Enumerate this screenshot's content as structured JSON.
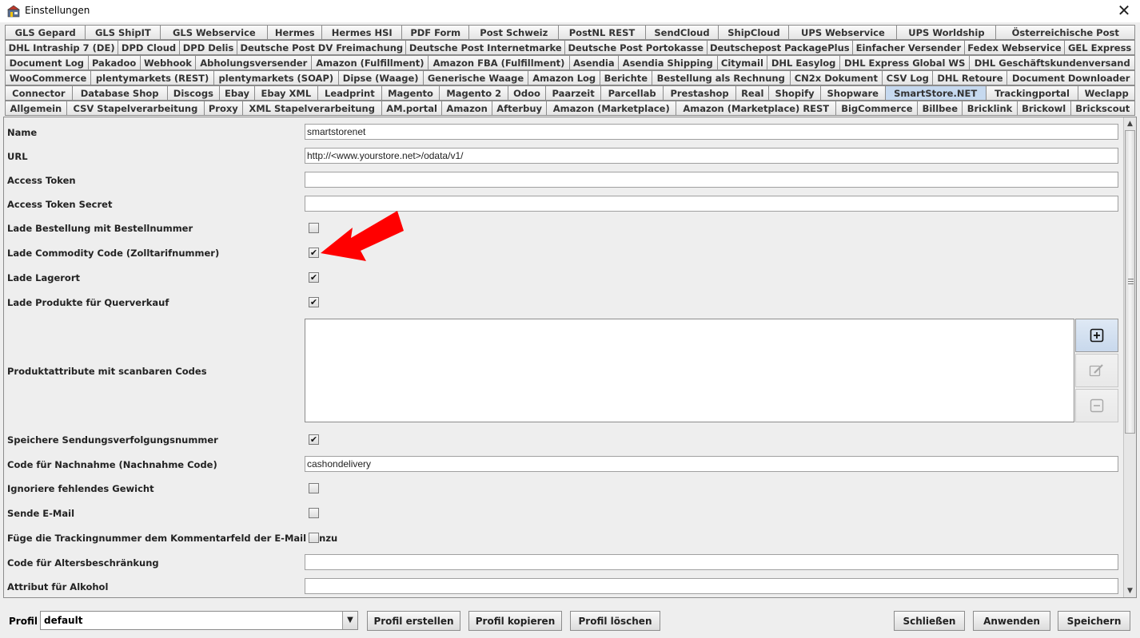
{
  "window": {
    "title": "Einstellungen",
    "close_icon": "close-icon"
  },
  "tab_rows": [
    [
      "GLS Gepard",
      "GLS ShipIT",
      "GLS Webservice",
      "Hermes",
      "Hermes HSI",
      "PDF Form",
      "Post Schweiz",
      "PostNL REST",
      "SendCloud",
      "ShipCloud",
      "UPS Webservice",
      "UPS Worldship",
      "Österreichische Post"
    ],
    [
      "DHL Intraship 7 (DE)",
      "DPD Cloud",
      "DPD Delis",
      "Deutsche Post DV Freimachung",
      "Deutsche Post Internetmarke",
      "Deutsche Post Portokasse",
      "Deutschepost PackagePlus",
      "Einfacher Versender",
      "Fedex Webservice",
      "GEL Express"
    ],
    [
      "Document Log",
      "Pakadoo",
      "Webhook",
      "Abholungsversender",
      "Amazon (Fulfillment)",
      "Amazon FBA (Fulfillment)",
      "Asendia",
      "Asendia Shipping",
      "Citymail",
      "DHL Easylog",
      "DHL Express Global WS",
      "DHL Geschäftskundenversand"
    ],
    [
      "WooCommerce",
      "plentymarkets (REST)",
      "plentymarkets (SOAP)",
      "Dipse (Waage)",
      "Generische Waage",
      "Amazon Log",
      "Berichte",
      "Bestellung als Rechnung",
      "CN2x Dokument",
      "CSV Log",
      "DHL Retoure",
      "Document Downloader"
    ],
    [
      "Connector",
      "Database Shop",
      "Discogs",
      "Ebay",
      "Ebay XML",
      "Leadprint",
      "Magento",
      "Magento 2",
      "Odoo",
      "Paarzeit",
      "Parcellab",
      "Prestashop",
      "Real",
      "Shopify",
      "Shopware",
      "SmartStore.NET",
      "Trackingportal",
      "Weclapp"
    ],
    [
      "Allgemein",
      "CSV Stapelverarbeitung",
      "Proxy",
      "XML Stapelverarbeitung",
      "AM.portal",
      "Amazon",
      "Afterbuy",
      "Amazon (Marketplace)",
      "Amazon (Marketplace) REST",
      "BigCommerce",
      "Billbee",
      "Bricklink",
      "Brickowl",
      "Brickscout"
    ]
  ],
  "active_tab": "SmartStore.NET",
  "form": {
    "name_label": "Name",
    "name_value": "smartstorenet",
    "url_label": "URL",
    "url_value": "http://<www.yourstore.net>/odata/v1/",
    "access_token_label": "Access Token",
    "access_token_value": "",
    "access_token_secret_label": "Access Token Secret",
    "access_token_secret_value": "",
    "lade_bestellung_label": "Lade Bestellung mit Bestellnummer",
    "lade_bestellung_checked": false,
    "lade_commodity_label": "Lade Commodity Code (Zolltarifnummer)",
    "lade_commodity_checked": true,
    "lade_lagerort_label": "Lade Lagerort",
    "lade_lagerort_checked": true,
    "lade_produkte_label": "Lade Produkte für Querverkauf",
    "lade_produkte_checked": true,
    "produktattribute_label": "Produktattribute mit scanbaren Codes",
    "speichere_label": "Speichere Sendungsverfolgungsnummer",
    "speichere_checked": true,
    "nachnahme_label": "Code für Nachnahme (Nachnahme Code)",
    "nachnahme_value": "cashondelivery",
    "ignoriere_label": "Ignoriere fehlendes Gewicht",
    "ignoriere_checked": false,
    "sende_email_label": "Sende E-Mail",
    "sende_email_checked": false,
    "fuege_label": "Füge die Trackingnummer dem Kommentarfeld der E-Mail hinzu",
    "fuege_checked": false,
    "alters_label": "Code für Altersbeschränkung",
    "alters_value": "",
    "alkohol_label": "Attribut für Alkohol",
    "alkohol_value": ""
  },
  "list_buttons": {
    "add_icon": "plus-icon",
    "edit_icon": "edit-icon",
    "remove_icon": "minus-icon"
  },
  "annotation": {
    "icon": "red-arrow-icon",
    "color": "#ff0000"
  },
  "bottom": {
    "profile_label": "Profil",
    "profile_value": "default",
    "create_label": "Profil erstellen",
    "copy_label": "Profil kopieren",
    "delete_label": "Profil löschen",
    "close_label": "Schließen",
    "apply_label": "Anwenden",
    "save_label": "Speichern"
  },
  "colors": {
    "active_tab": "#c6d9ef",
    "background": "#eeeeee"
  }
}
